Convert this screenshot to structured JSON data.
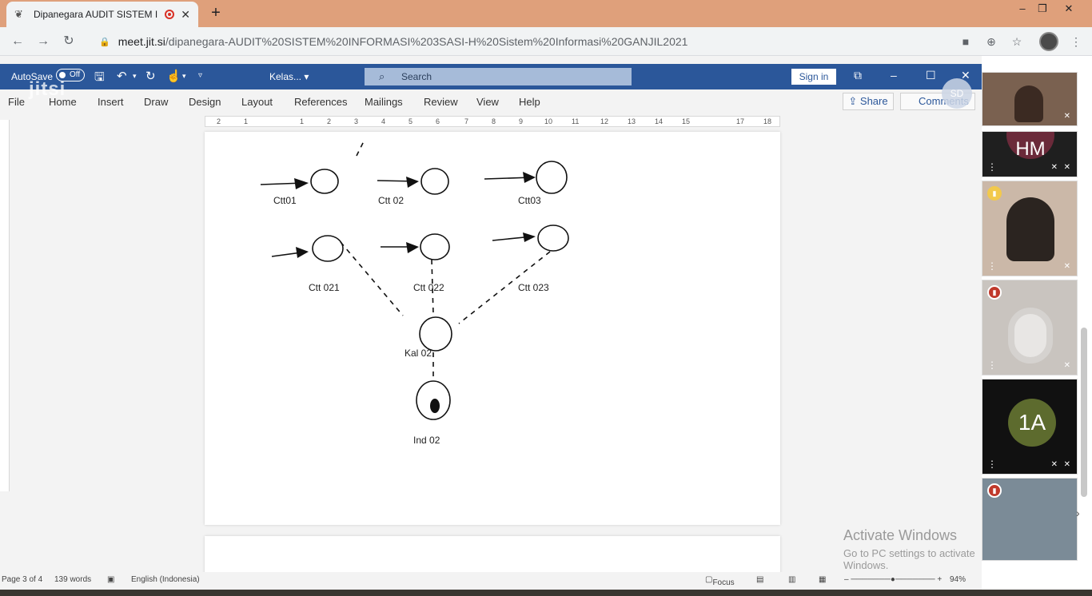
{
  "browser": {
    "tab_title": "Dipanegara AUDIT SISTEM II",
    "new_tab": "+",
    "close_tab": "✕",
    "url_host": "meet.jit.si",
    "url_path": "/dipanegara-AUDIT%20SISTEM%20INFORMASI%203SASI-H%20Sistem%20Informasi%20GANJIL2021",
    "win_min": "–",
    "win_restore": "❐",
    "win_close": "✕"
  },
  "jitsi": {
    "logo": "jitsi"
  },
  "word": {
    "autosave_label": "AutoSave",
    "autosave_state": "Off",
    "doc_name": "Kelas...",
    "search_placeholder": "Search",
    "sign_in": "Sign in",
    "menu": [
      "File",
      "Home",
      "Insert",
      "Draw",
      "Design",
      "Layout",
      "References",
      "Mailings",
      "Review",
      "View",
      "Help"
    ],
    "share": "Share",
    "comments": "Comments",
    "user_initials": "SD",
    "ruler": [
      "2",
      "1",
      "1",
      "2",
      "3",
      "4",
      "5",
      "6",
      "7",
      "8",
      "9",
      "10",
      "11",
      "12",
      "13",
      "14",
      "15",
      "17",
      "18"
    ],
    "diagram": {
      "nodes": [
        "Ctt01",
        "Ctt 02",
        "Ctt03",
        "Ctt 021",
        "Ctt 022",
        "Ctt 023",
        "Kal 02.",
        "Ind 02"
      ]
    },
    "status": {
      "page": "Page 3 of 4",
      "words": "139 words",
      "language": "English (Indonesia)",
      "focus": "Focus",
      "zoom": "94%"
    }
  },
  "windows_activation": {
    "line1": "Activate Windows",
    "line2": "Go to PC settings to activate Windows."
  },
  "participants": [
    {
      "type": "video"
    },
    {
      "type": "avatar",
      "initials": "HM"
    },
    {
      "type": "video"
    },
    {
      "type": "video"
    },
    {
      "type": "avatar",
      "initials": "1A"
    },
    {
      "type": "video"
    }
  ]
}
